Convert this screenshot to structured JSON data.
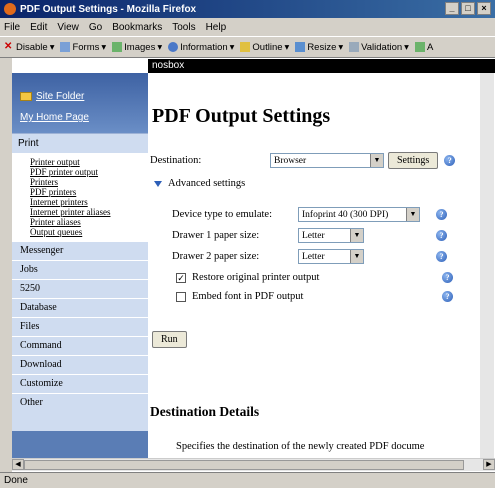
{
  "window": {
    "title": "PDF Output Settings - Mozilla Firefox"
  },
  "menubar": [
    "File",
    "Edit",
    "View",
    "Go",
    "Bookmarks",
    "Tools",
    "Help"
  ],
  "toolbar": [
    "Disable",
    "Forms",
    "Images",
    "Information",
    "Outline",
    "Resize",
    "Validation",
    "A"
  ],
  "header_strip": "nosbox",
  "sidebar": {
    "folder": "Site Folder",
    "home": "My Home Page",
    "print": "Print",
    "print_links": [
      "Printer output",
      "PDF printer output",
      "Printers",
      "PDF printers",
      "Internet printers",
      "Internet printer aliases",
      "Printer aliases",
      "Output queues"
    ],
    "categories": [
      "Messenger",
      "Jobs",
      "5250",
      "Database",
      "Files",
      "Command",
      "Download",
      "Customize",
      "Other"
    ]
  },
  "main": {
    "title": "PDF Output Settings",
    "destination_label": "Destination:",
    "destination_value": "Browser",
    "settings_button": "Settings",
    "advanced": "Advanced settings",
    "device_label": "Device type to emulate:",
    "device_value": "Infoprint 40 (300 DPI)",
    "drawer1_label": "Drawer 1 paper size:",
    "drawer1_value": "Letter",
    "drawer2_label": "Drawer 2 paper size:",
    "drawer2_value": "Letter",
    "restore_label": "Restore original printer output",
    "restore_checked": true,
    "embed_label": "Embed font in PDF output",
    "embed_checked": false,
    "run_button": "Run",
    "details_title": "Destination Details",
    "details_text": "Specifies the destination of the newly created PDF docume"
  },
  "status": "Done"
}
